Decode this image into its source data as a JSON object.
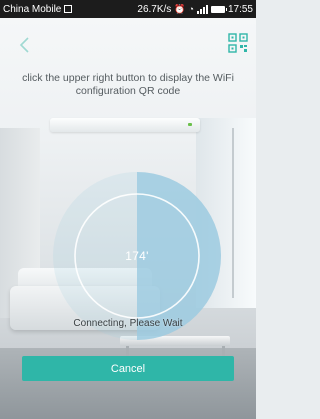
{
  "status_bar": {
    "carrier": "China Mobile",
    "network_speed": "26.7K/s",
    "time": "17:55"
  },
  "header": {
    "back_icon": "chevron-left-icon",
    "qr_icon": "qr-code-icon"
  },
  "instruction": "click the upper right button to display the WiFi configuration QR code",
  "progress": {
    "value_text": "174'",
    "fraction": 0.5
  },
  "wait_text": "Connecting, Please Wait",
  "cancel_label": "Cancel",
  "colors": {
    "accent": "#2fb6a8",
    "ring_fill": "#9ccbe0",
    "status_bar": "#1c1c1c"
  }
}
